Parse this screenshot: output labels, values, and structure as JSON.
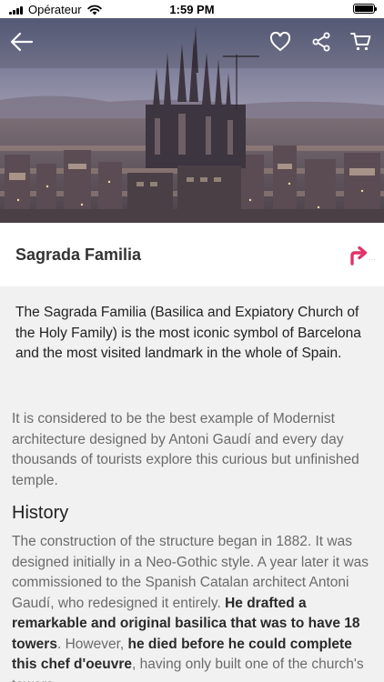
{
  "status_bar": {
    "carrier": "Opérateur",
    "time": "1:59 PM"
  },
  "hero": {
    "image": "sagrada-familia-barcelona-dusk-photo",
    "nav_icons": [
      "back-arrow-icon",
      "heart-icon",
      "share-icon",
      "cart-icon"
    ]
  },
  "place": {
    "title": "Sagrada Familia",
    "directions_icon": "directions-arrow-icon",
    "directions_color": "#e0336b"
  },
  "content": {
    "intro": "The Sagrada Familia (Basilica and Expiatory Church of the Holy Family) is the most iconic symbol of Barcelona and the most visited landmark in the whole of Spain.",
    "paragraph": "It is considered to be the best example of Modernist architecture designed by Antoni Gaudí and every day thousands of tourists explore this curious but unfinished temple.",
    "section_title": "History",
    "history": {
      "part1": "The construction of the structure began in 1882. It was designed initially in a Neo-Gothic style. A year later it was commissioned to the Spanish Catalan architect Antoni Gaudí, who redesigned it entirely. ",
      "bold1": "He drafted a remarkable and original basilica that was to have 18 towers",
      "part2": ". However, ",
      "bold2": "he died before he could complete this chef d'oeuvre",
      "part3": ", having only built one of the church's towers."
    }
  }
}
